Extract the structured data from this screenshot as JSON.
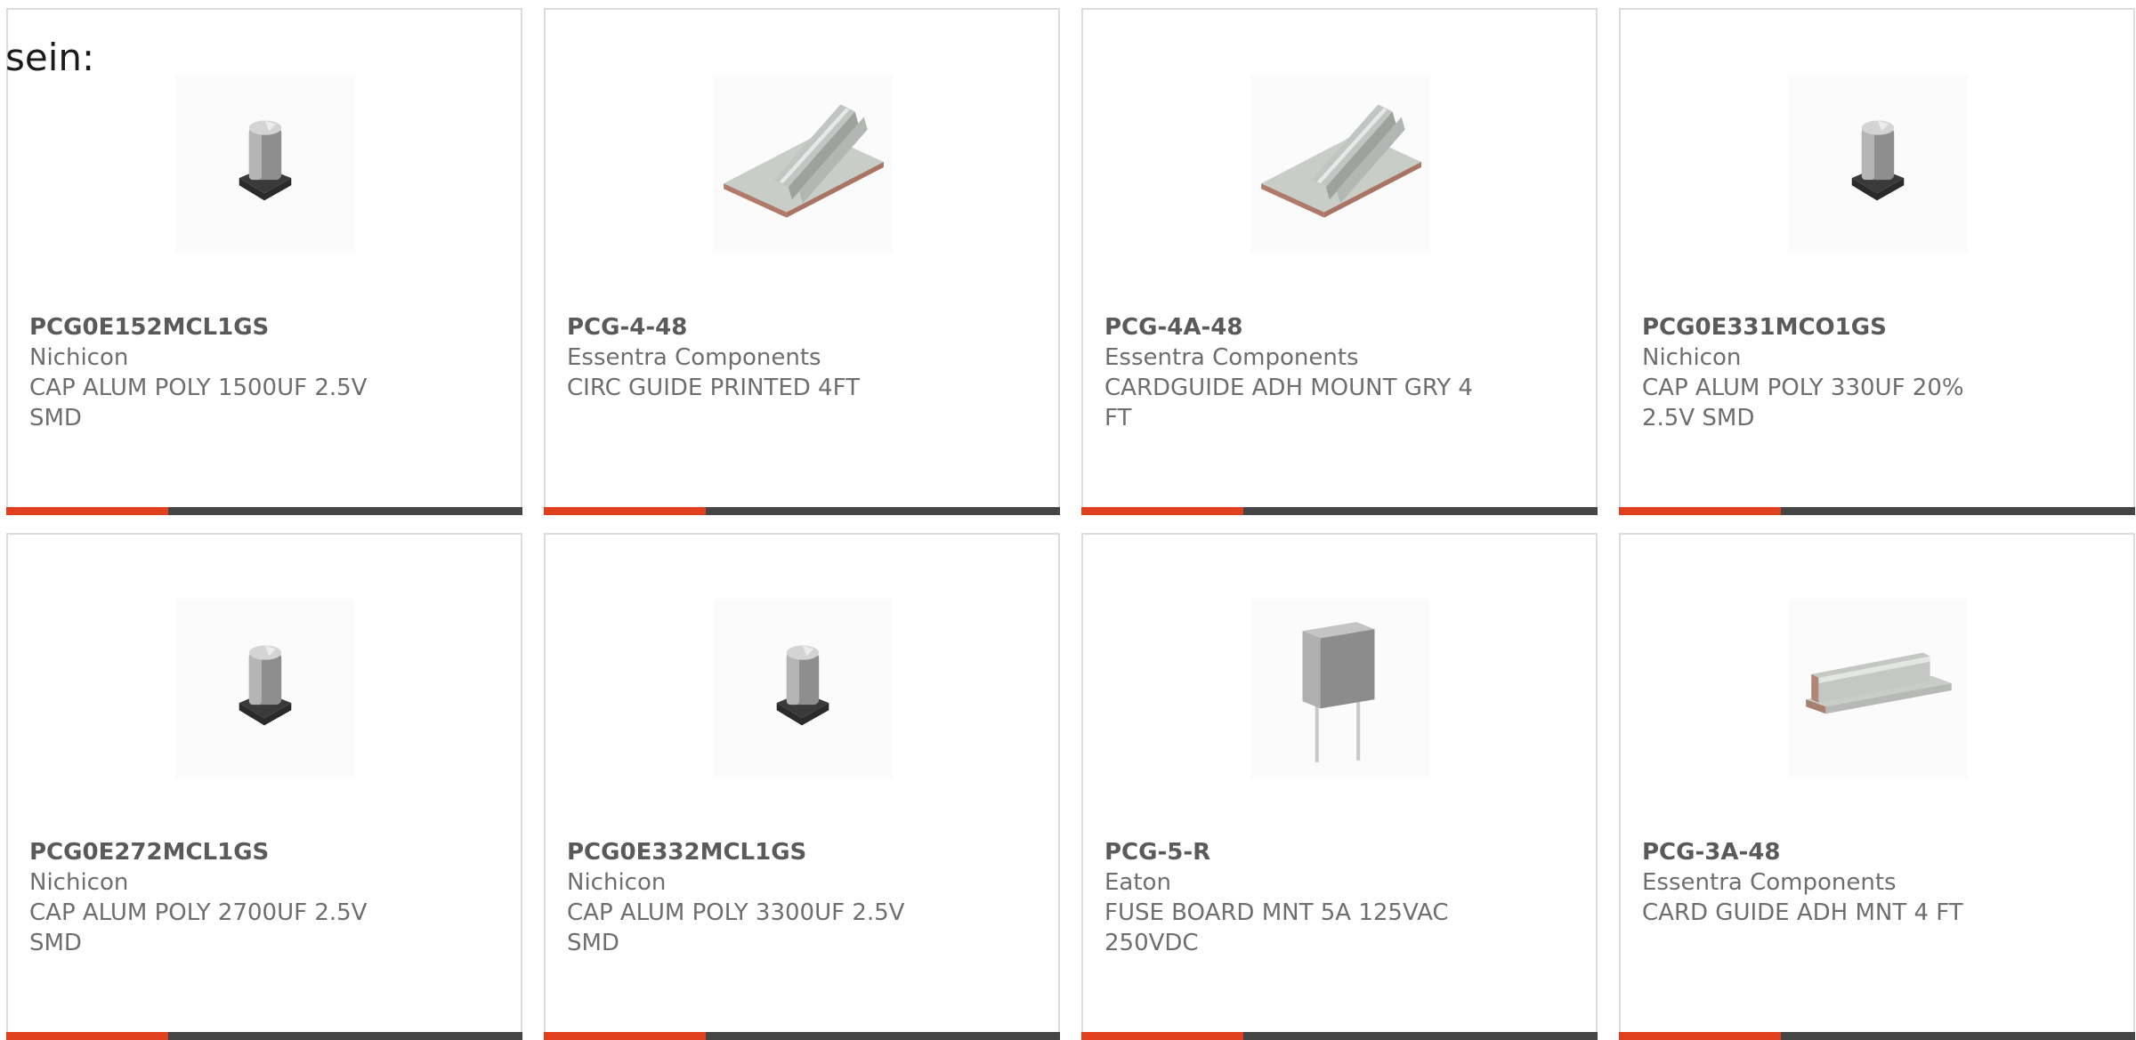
{
  "page": {
    "intro_text": "sein:"
  },
  "products": [
    {
      "part_number": "PCG0E152MCL1GS",
      "manufacturer": "Nichicon",
      "description": "CAP ALUM POLY 1500UF 2.5V SMD",
      "image": "smd-capacitor-icon"
    },
    {
      "part_number": "PCG-4-48",
      "manufacturer": "Essentra Components",
      "description": "CIRC GUIDE PRINTED 4FT",
      "image": "card-guide-icon"
    },
    {
      "part_number": "PCG-4A-48",
      "manufacturer": "Essentra Components",
      "description": "CARDGUIDE ADH MOUNT GRY 4 FT",
      "image": "card-guide-icon"
    },
    {
      "part_number": "PCG0E331MCO1GS",
      "manufacturer": "Nichicon",
      "description": "CAP ALUM POLY 330UF 20% 2.5V SMD",
      "image": "smd-capacitor-icon"
    },
    {
      "part_number": "PCG0E272MCL1GS",
      "manufacturer": "Nichicon",
      "description": "CAP ALUM POLY 2700UF 2.5V SMD",
      "image": "smd-capacitor-icon"
    },
    {
      "part_number": "PCG0E332MCL1GS",
      "manufacturer": "Nichicon",
      "description": "CAP ALUM POLY 3300UF 2.5V SMD",
      "image": "smd-capacitor-icon"
    },
    {
      "part_number": "PCG-5-R",
      "manufacturer": "Eaton",
      "description": "FUSE BOARD MNT 5A 125VAC 250VDC",
      "image": "fuse-icon"
    },
    {
      "part_number": "PCG-3A-48",
      "manufacturer": "Essentra Components",
      "description": "CARD GUIDE ADH MNT 4 FT",
      "image": "card-guide-flat-icon"
    }
  ],
  "colors": {
    "accent": "#e0401e",
    "bar": "#454545",
    "border": "#dcdcdc",
    "text": "#6e6e6e"
  }
}
